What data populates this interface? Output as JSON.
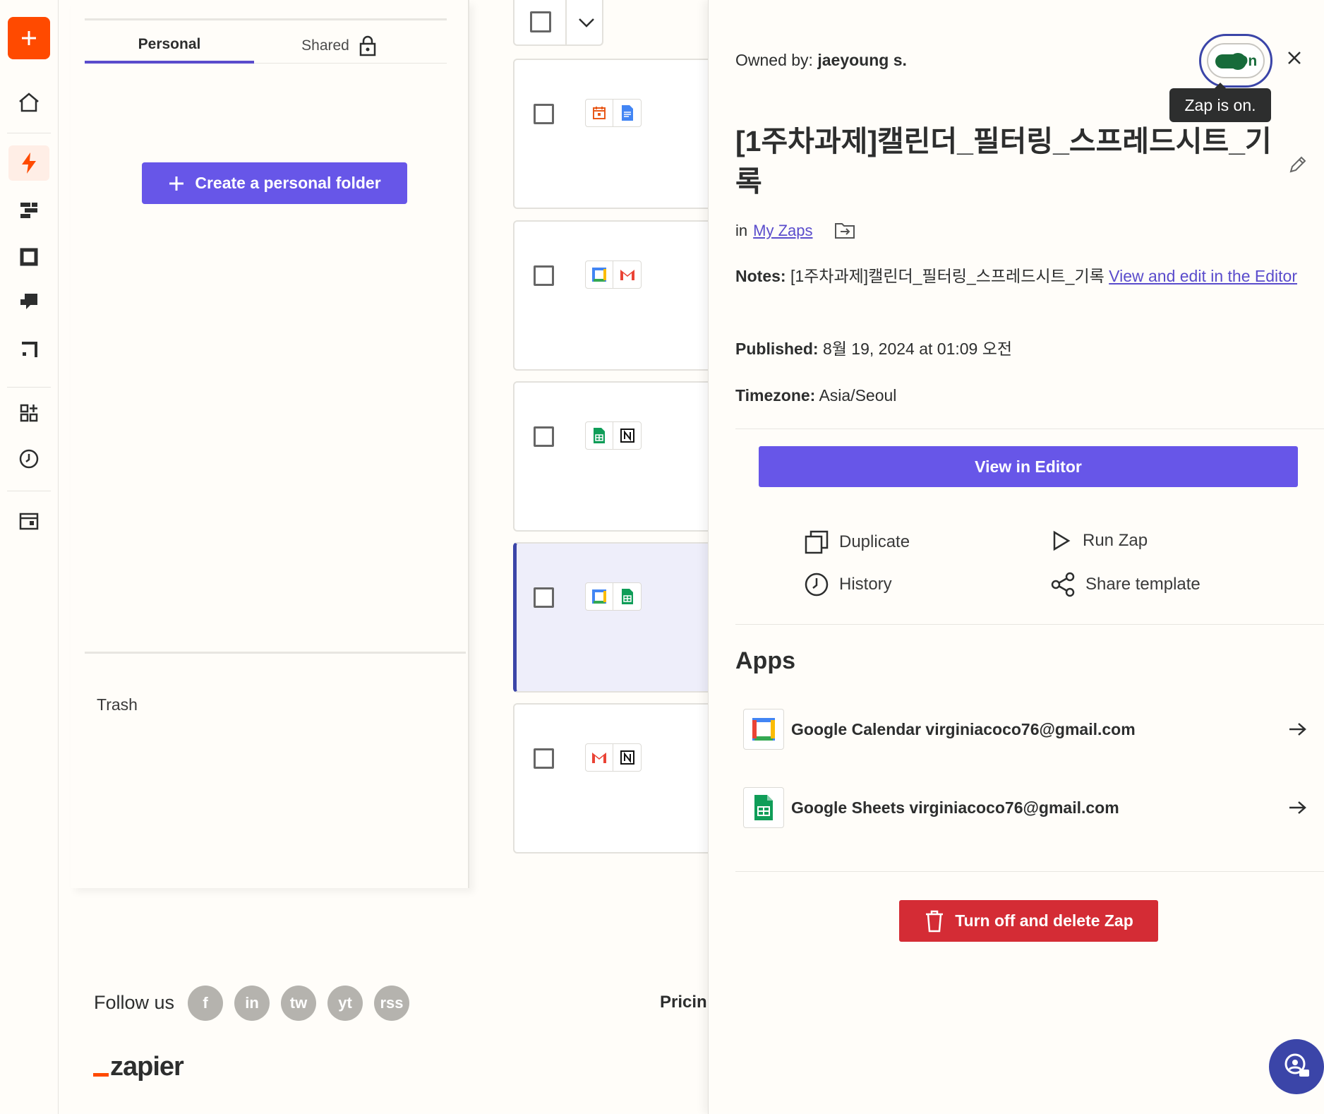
{
  "rail": {
    "icons": [
      "plus-icon",
      "home-icon",
      "zap-icon",
      "tables-icon",
      "interfaces-icon",
      "chatbots-icon",
      "canvas-icon",
      "apps-icon",
      "history-icon",
      "discover-icon"
    ]
  },
  "folders": {
    "tab_personal": "Personal",
    "tab_shared": "Shared",
    "create_folder_label": "Create a personal folder",
    "trash_label": "Trash"
  },
  "zap_rows": [
    {
      "apps": [
        "calendar-orange-icon",
        "google-docs-icon"
      ],
      "selected": false
    },
    {
      "apps": [
        "google-calendar-icon",
        "gmail-icon"
      ],
      "selected": false
    },
    {
      "apps": [
        "google-sheets-icon",
        "notion-icon"
      ],
      "selected": false
    },
    {
      "apps": [
        "google-calendar-icon",
        "google-sheets-icon"
      ],
      "selected": true
    },
    {
      "apps": [
        "gmail-icon",
        "notion-icon"
      ],
      "selected": false
    }
  ],
  "footer": {
    "follow_us": "Follow us",
    "social": [
      "f",
      "in",
      "tw",
      "yt",
      "rss"
    ],
    "logo": "zapier",
    "pricing": "Pricin"
  },
  "detail": {
    "owned_label": "Owned by:",
    "owner": "jaeyoung s.",
    "toggle_label": "On",
    "tooltip": "Zap is on.",
    "title": "[1주차과제]캘린더_필터링_스프레드시트_기록",
    "in_label": "in",
    "folder_link": "My Zaps",
    "notes_label": "Notes:",
    "notes_value": "[1주차과제]캘린더_필터링_스프레드시트_기록",
    "notes_link": "View and edit in the Editor",
    "published_label": "Published:",
    "published_value": "8월 19, 2024 at 01:09 오전",
    "timezone_label": "Timezone:",
    "timezone_value": "Asia/Seoul",
    "view_editor": "View in Editor",
    "actions": {
      "duplicate": "Duplicate",
      "run_zap": "Run Zap",
      "history": "History",
      "share_template": "Share template"
    },
    "apps_heading": "Apps",
    "apps": [
      {
        "name": "Google Calendar virginiacoco76@gmail.com",
        "icon": "google-calendar-icon"
      },
      {
        "name": "Google Sheets virginiacoco76@gmail.com",
        "icon": "google-sheets-icon"
      }
    ],
    "delete_label": "Turn off and delete Zap"
  },
  "colors": {
    "accent": "#6756e8",
    "brand_orange": "#ff4a00",
    "toggle_green": "#176b3a",
    "danger": "#d42c35",
    "focus_blue": "#3b45a8"
  }
}
